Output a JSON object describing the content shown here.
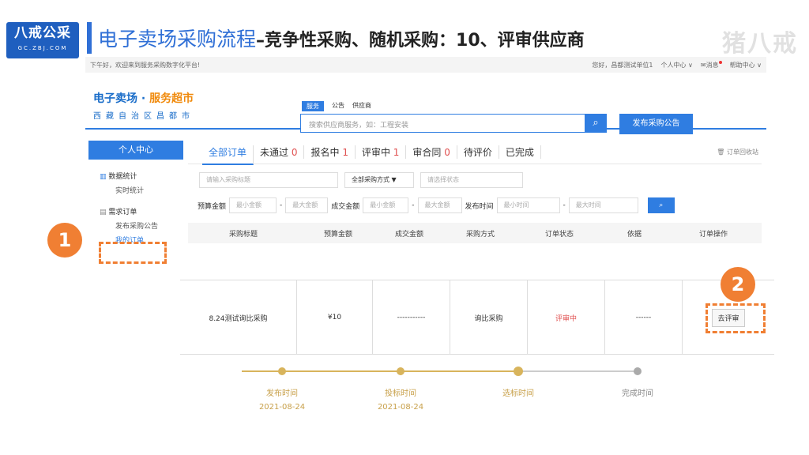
{
  "slide": {
    "logo_main": "八戒公采",
    "logo_sub": "GC.ZBJ.COM",
    "title_blue": "电子卖场采购流程",
    "title_dark": "–竞争性采购、随机采购：10、评审供应商",
    "watermark": "猪八戒"
  },
  "topbar": {
    "greeting": "下午好，欢迎来到服务采购数字化平台!",
    "user": "您好，昌都测试单位1",
    "personal_center": "个人中心 ∨",
    "messages": "消息",
    "help": "帮助中心 ∨"
  },
  "brand": {
    "name_main": "电子卖场 · ",
    "name_accent": "服务超市",
    "region": "西藏自治区昌都市"
  },
  "search": {
    "tabs": [
      "服务",
      "公告",
      "供应商"
    ],
    "placeholder": "搜索供应商服务，如：工程安装",
    "button_icon": "⌕",
    "publish": "发布采购公告"
  },
  "sidebar": {
    "center": "个人中心",
    "section_stats": "数据统计",
    "realtime": "实时统计",
    "section_orders": "需求订单",
    "publish_notice": "发布采购公告",
    "my_orders": "我的订单"
  },
  "order_tabs": [
    {
      "label": "全部订单",
      "num": ""
    },
    {
      "label": "未通过 ",
      "num": "0"
    },
    {
      "label": "报名中 ",
      "num": "1"
    },
    {
      "label": "评审中 ",
      "num": "1"
    },
    {
      "label": "审合同 ",
      "num": "0"
    },
    {
      "label": "待评价",
      "num": ""
    },
    {
      "label": "已完成",
      "num": ""
    }
  ],
  "recycle": "订单回收站",
  "filters": {
    "title_placeholder": "请输入采购标题",
    "method": "全部采购方式 ▼",
    "status_placeholder": "请选择状态",
    "budget_label": "预算金额",
    "deal_label": "成交金额",
    "time_label": "发布时间",
    "min_amount": "最小金额",
    "max_amount": "最大金额",
    "min_time": "最小时间",
    "max_time": "最大时间",
    "dash": "-",
    "query_icon": "⌕"
  },
  "table_headers": [
    "采购标题",
    "预算金额",
    "成交金额",
    "采购方式",
    "订单状态",
    "依据",
    "订单操作"
  ],
  "order_row": {
    "title": "8.24测试询比采购",
    "budget": "¥10",
    "deal": "-----------",
    "method": "询比采购",
    "status": "评审中",
    "basis": "------",
    "action": "去评审"
  },
  "progress": [
    {
      "label": "发布时间",
      "date": "2021-08-24"
    },
    {
      "label": "投标时间",
      "date": "2021-08-24"
    },
    {
      "label": "选标时间",
      "date": ""
    },
    {
      "label": "完成时间",
      "date": ""
    }
  ],
  "callouts": [
    "1",
    "2"
  ],
  "colors": {
    "accent": "#2f7de1",
    "callout": "#f07f33",
    "status": "#e05050",
    "progress": "#d8b45c"
  }
}
